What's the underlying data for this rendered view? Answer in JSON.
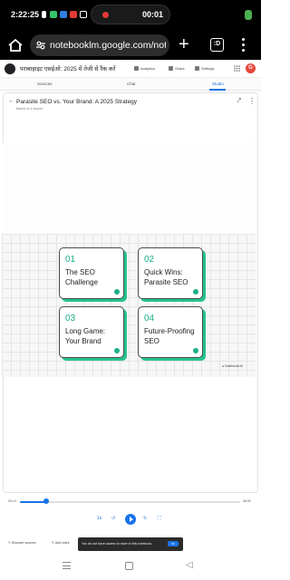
{
  "status_bar": {
    "time": "2:22:25",
    "recording_time": "00:01"
  },
  "browser": {
    "url": "notebooklm.google.com/note",
    "tab_count": ":D",
    "new_tab_symbol": "+"
  },
  "notebook": {
    "title": "पराबाहाइट एसईओ: 2025 में तेजी से रैंक करें",
    "analytics_label": "Analytics",
    "share_label": "Share",
    "settings_label": "Settings",
    "avatar_letter": "G"
  },
  "tabs": [
    {
      "label": "Sources",
      "active": false
    },
    {
      "label": "Chat",
      "active": false
    },
    {
      "label": "Studio",
      "active": true
    }
  ],
  "studio": {
    "title": "Parasite SEO vs. Your Brand: A 2025 Strategy",
    "subtitle": "Based on 1 source",
    "cards": [
      {
        "number": "01",
        "title": "The SEO Challenge"
      },
      {
        "number": "02",
        "title": "Quick Wins: Parasite SEO"
      },
      {
        "number": "03",
        "title": "Long Game: Your Brand"
      },
      {
        "number": "04",
        "title": "Future-Proofing SEO"
      }
    ],
    "watermark": "NotebookLM"
  },
  "player": {
    "current_time": "00:14",
    "total_time": "06:00",
    "progress": 0.12,
    "speed": "1x"
  },
  "bottom_bar": {
    "discover_label": "Discover sources",
    "add_label": "Add notes",
    "toast_text": "You do not have access to save to this notebook.",
    "toast_action": "OK"
  }
}
